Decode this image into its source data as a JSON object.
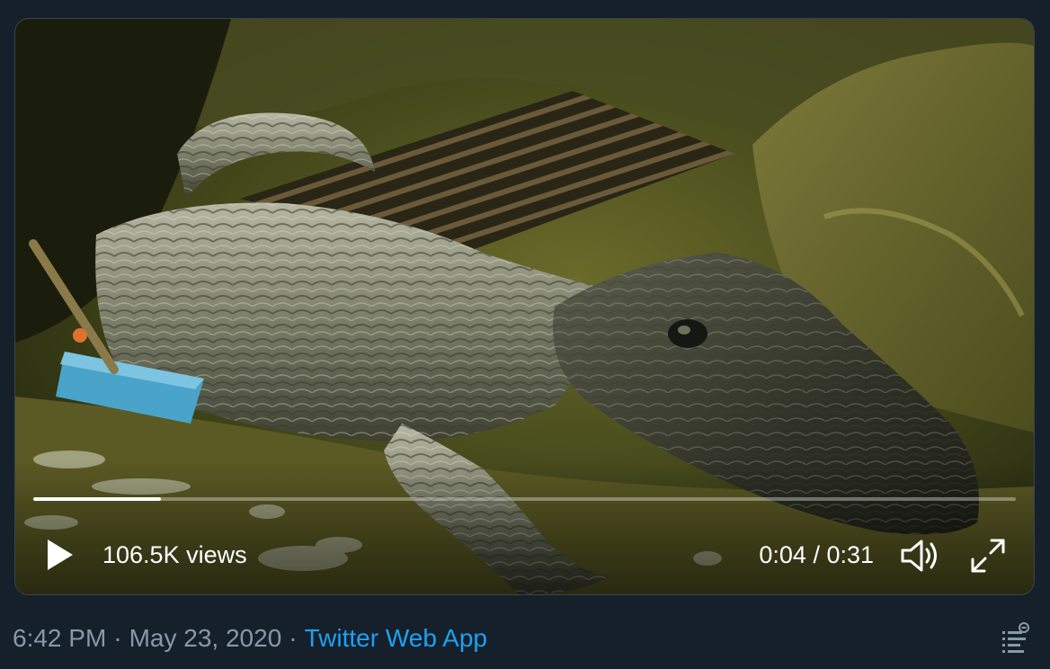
{
  "player": {
    "views": "106.5K views",
    "time": "0:04 / 0:31",
    "progress_fraction": 0.13,
    "play_icon": "play-icon",
    "volume_icon": "volume-icon",
    "fullscreen_icon": "fullscreen-icon"
  },
  "meta": {
    "time": "6:42 PM",
    "separator": "·",
    "date": "May 23, 2020",
    "source": "Twitter Web App",
    "analytics_icon": "analytics-icon"
  },
  "colors": {
    "background": "#15202b",
    "link": "#1da1f2",
    "muted": "#8899a6"
  }
}
